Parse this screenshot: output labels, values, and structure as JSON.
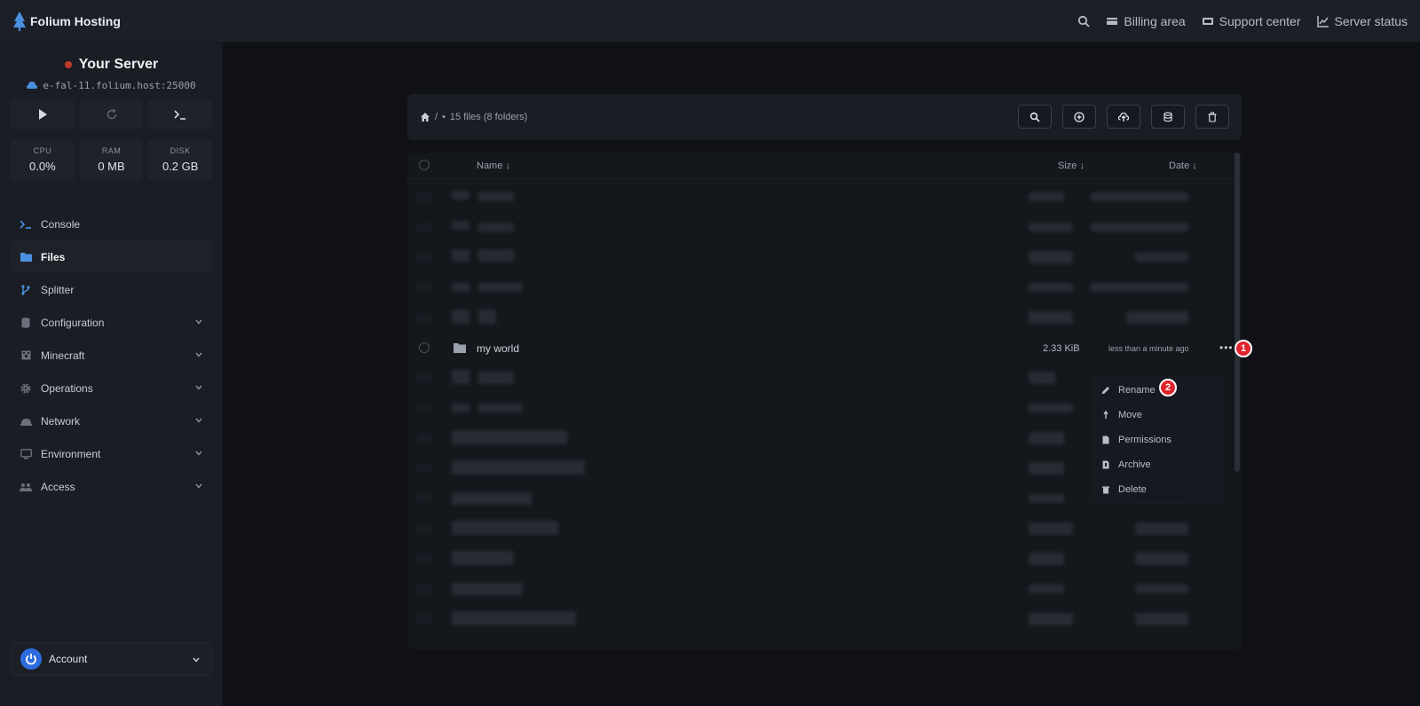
{
  "brand": {
    "name": "Folium Hosting"
  },
  "topnav": {
    "items": [
      {
        "label": "Billing area",
        "icon": "card-icon"
      },
      {
        "label": "Support center",
        "icon": "ticket-icon"
      },
      {
        "label": "Server status",
        "icon": "chart-icon"
      }
    ]
  },
  "server": {
    "name": "Your Server",
    "status_color": "#c0392b",
    "host": "e-fal-11.folium.host:25000"
  },
  "stats": [
    {
      "label": "CPU",
      "value": "0.0%"
    },
    {
      "label": "RAM",
      "value": "0 MB"
    },
    {
      "label": "DISK",
      "value": "0.2 GB"
    }
  ],
  "menu": [
    {
      "label": "Console",
      "icon": "terminal-icon",
      "active": false,
      "expandable": false
    },
    {
      "label": "Files",
      "icon": "folder-icon",
      "active": true,
      "expandable": false
    },
    {
      "label": "Splitter",
      "icon": "branch-icon",
      "active": false,
      "expandable": false
    },
    {
      "label": "Configuration",
      "icon": "database-icon",
      "active": false,
      "expandable": true
    },
    {
      "label": "Minecraft",
      "icon": "cube-icon",
      "active": false,
      "expandable": true
    },
    {
      "label": "Operations",
      "icon": "gear-icon",
      "active": false,
      "expandable": true
    },
    {
      "label": "Network",
      "icon": "network-icon",
      "active": false,
      "expandable": true
    },
    {
      "label": "Environment",
      "icon": "monitor-icon",
      "active": false,
      "expandable": true
    },
    {
      "label": "Access",
      "icon": "users-icon",
      "active": false,
      "expandable": true
    }
  ],
  "account": {
    "label": "Account"
  },
  "files": {
    "summary": "15 files (8 folders)",
    "columns": {
      "name": "Name ↓",
      "size": "Size ↓",
      "date": "Date ↓"
    },
    "highlighted_row": {
      "name": "my world",
      "size": "2.33 KiB",
      "date": "less than a minute ago"
    },
    "context_menu": [
      {
        "label": "Rename",
        "icon": "pencil-icon"
      },
      {
        "label": "Move",
        "icon": "move-icon"
      },
      {
        "label": "Permissions",
        "icon": "file-icon"
      },
      {
        "label": "Archive",
        "icon": "archive-icon"
      },
      {
        "label": "Delete",
        "icon": "trash-icon"
      }
    ]
  },
  "badges": {
    "first": "1",
    "second": "2"
  },
  "colors": {
    "accent": "#4a8fe0",
    "badge": "#e0242b"
  }
}
